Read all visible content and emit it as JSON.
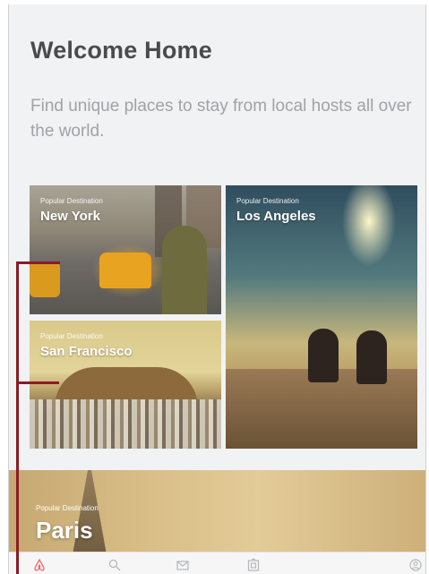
{
  "header": {
    "title": "Welcome Home",
    "subtitle": "Find unique places to stay from local hosts all over the world."
  },
  "destinations": [
    {
      "kicker": "Popular Destination",
      "name": "New York"
    },
    {
      "kicker": "Popular Destination",
      "name": "Los Angeles"
    },
    {
      "kicker": "Popular Destination",
      "name": "San Francisco"
    },
    {
      "kicker": "Popular Destination",
      "name": "Paris"
    }
  ],
  "tabbar": {
    "items": [
      {
        "icon": "airbnb-logo-icon",
        "active": true
      },
      {
        "icon": "search-icon",
        "active": false
      },
      {
        "icon": "message-icon",
        "active": false
      },
      {
        "icon": "trips-icon",
        "active": false
      },
      {
        "icon": "profile-icon",
        "active": false
      }
    ]
  },
  "colors": {
    "accent": "#ff5a5f",
    "marker": "#8b1c24",
    "title": "#4b4b4b",
    "subtitle": "#9fa3a7"
  }
}
